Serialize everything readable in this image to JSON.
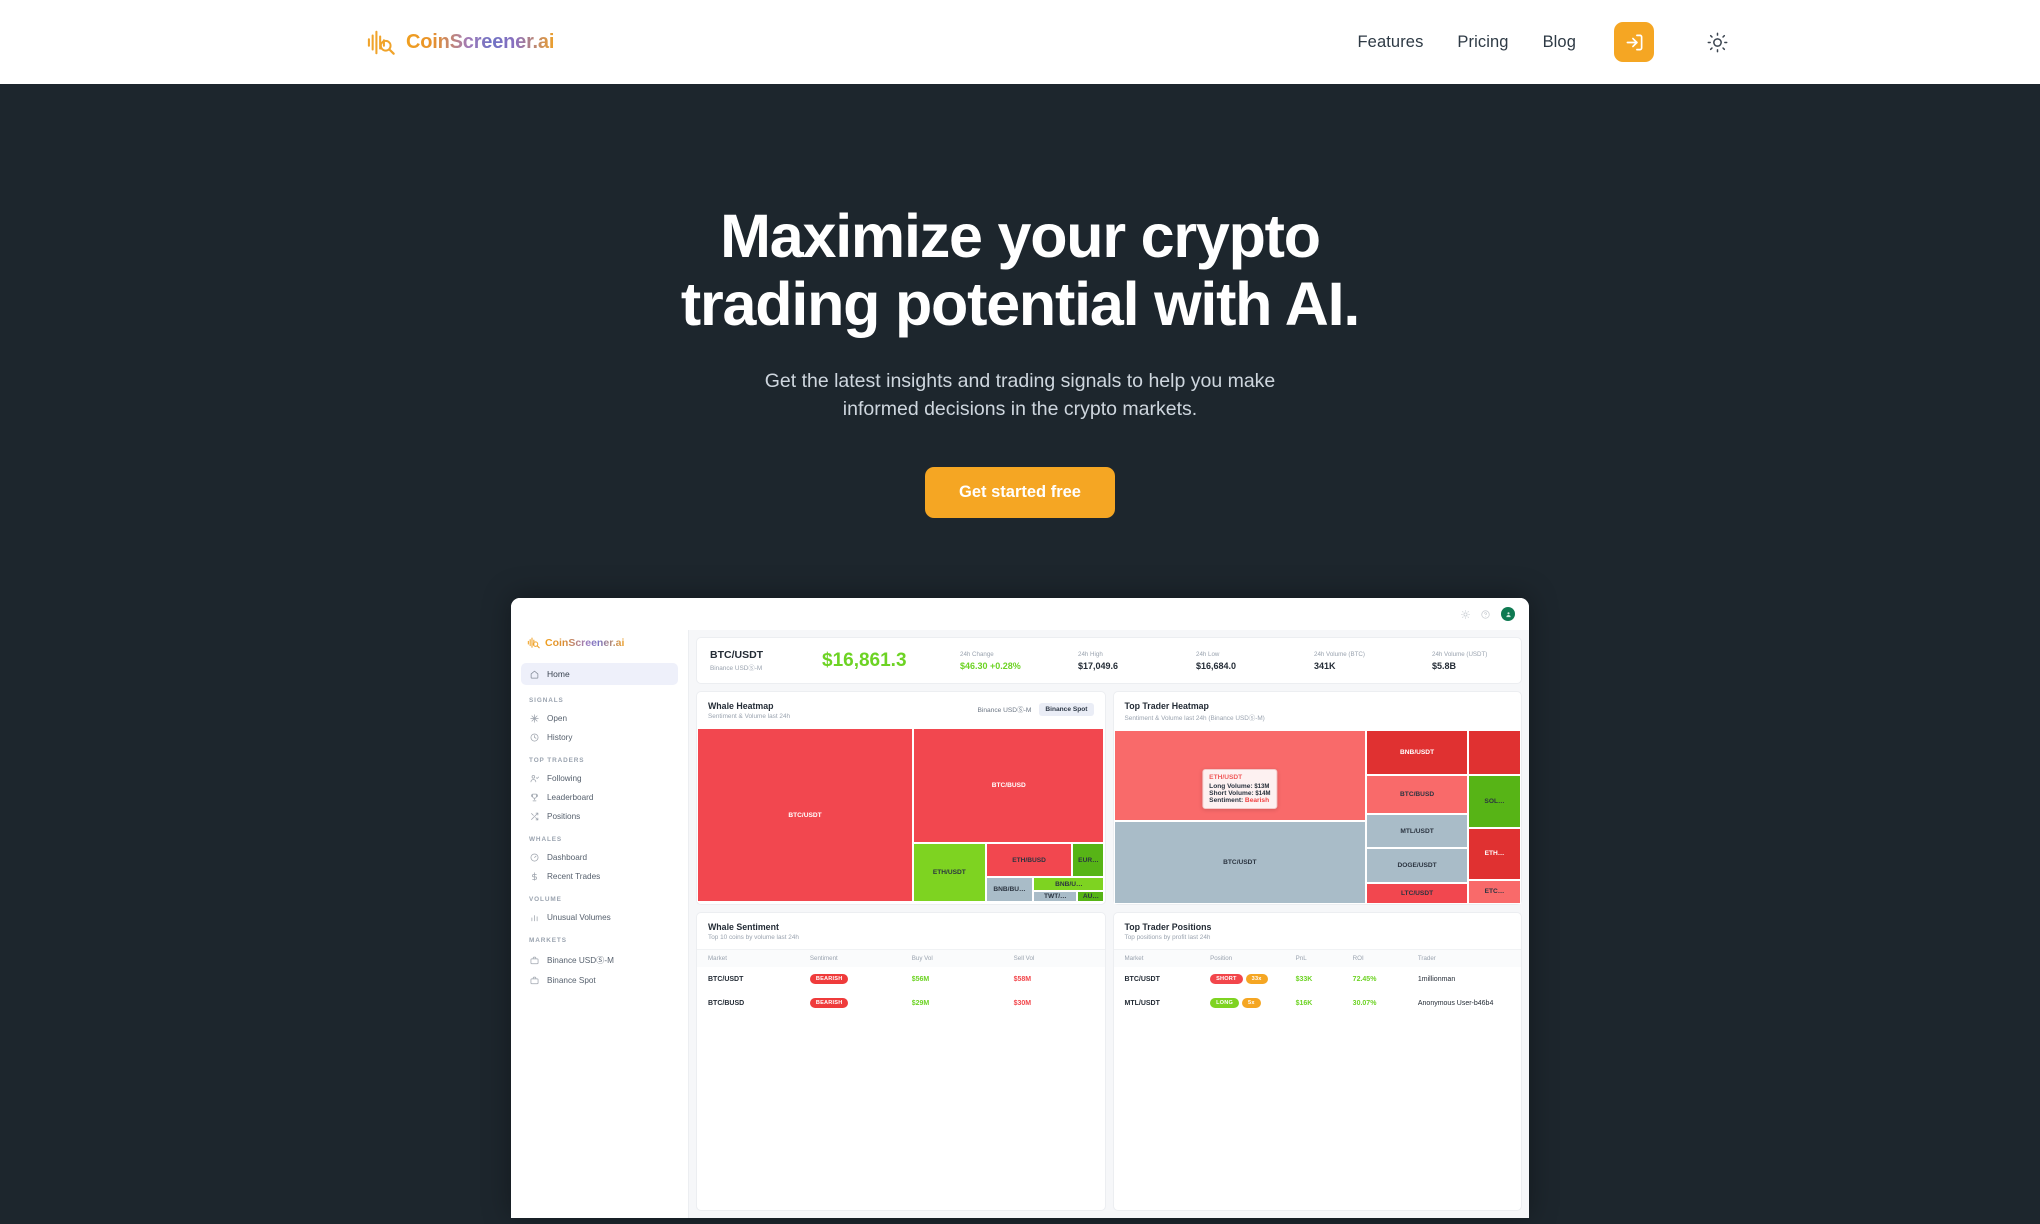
{
  "site": {
    "brand": "CoinScreener.ai",
    "accent": "#f5a623",
    "nav": [
      {
        "label": "Features"
      },
      {
        "label": "Pricing"
      },
      {
        "label": "Blog"
      }
    ],
    "login_icon": "login-arrow-icon",
    "theme_icon": "sun-icon"
  },
  "hero": {
    "title_line1": "Maximize your crypto",
    "title_line2": "trading potential with AI.",
    "subtitle_line1": "Get the latest insights and trading signals to help you make",
    "subtitle_line2": "informed decisions in the crypto markets.",
    "cta": "Get started free"
  },
  "dashboard": {
    "brand": "CoinScreener.ai",
    "topbar_icons": [
      "sun-icon",
      "help-icon",
      "avatar"
    ],
    "sidebar": {
      "active": {
        "label": "Home",
        "icon": "home-icon"
      },
      "groups": [
        {
          "title": "SIGNALS",
          "items": [
            {
              "label": "Open",
              "icon": "sparkle-icon"
            },
            {
              "label": "History",
              "icon": "clock-icon"
            }
          ]
        },
        {
          "title": "TOP TRADERS",
          "items": [
            {
              "label": "Following",
              "icon": "user-check-icon"
            },
            {
              "label": "Leaderboard",
              "icon": "trophy-icon"
            },
            {
              "label": "Positions",
              "icon": "shuffle-icon"
            }
          ]
        },
        {
          "title": "WHALES",
          "items": [
            {
              "label": "Dashboard",
              "icon": "gauge-icon"
            },
            {
              "label": "Recent Trades",
              "icon": "dollar-icon"
            }
          ]
        },
        {
          "title": "VOLUME",
          "items": [
            {
              "label": "Unusual Volumes",
              "icon": "bar-chart-icon"
            }
          ]
        },
        {
          "title": "MARKETS",
          "items": [
            {
              "label": "Binance USDⓈ-M",
              "icon": "briefcase-icon"
            },
            {
              "label": "Binance Spot",
              "icon": "briefcase-icon"
            }
          ]
        }
      ]
    },
    "ticker": {
      "pair": "BTC/USDT",
      "exchange": "Binance USDⓈ-M",
      "price": "$16,861.3",
      "stats": [
        {
          "label": "24h Change",
          "value": "$46.30 +0.28%",
          "up": true
        },
        {
          "label": "24h High",
          "value": "$17,049.6",
          "up": false
        },
        {
          "label": "24h Low",
          "value": "$16,684.0",
          "up": false
        },
        {
          "label": "24h Volume (BTC)",
          "value": "341K",
          "up": false
        },
        {
          "label": "24h Volume (USDT)",
          "value": "$5.8B",
          "up": false
        }
      ]
    },
    "whale_heatmap": {
      "title": "Whale Heatmap",
      "subtitle": "Sentiment & Volume last 24h",
      "segments": [
        {
          "label": "Binance USDⓈ-M",
          "selected": false
        },
        {
          "label": "Binance Spot",
          "selected": true
        }
      ]
    },
    "trader_heatmap": {
      "title": "Top Trader Heatmap",
      "subtitle": "Sentiment & Volume last 24h (Binance USDⓈ-M)",
      "tooltip": {
        "pair": "ETH/USDT",
        "long_label": "Long Volume:",
        "long_value": "$13M",
        "short_label": "Short Volume:",
        "short_value": "$14M",
        "sentiment_label": "Sentiment:",
        "sentiment_value": "Bearish"
      }
    },
    "whale_sentiment": {
      "title": "Whale Sentiment",
      "subtitle": "Top 10 coins by volume last 24h",
      "columns": [
        "Market",
        "Sentiment",
        "Buy Vol",
        "Sell Vol"
      ],
      "rows": [
        {
          "market": "BTC/USDT",
          "sentiment": "BEARISH",
          "buy": "$56M",
          "sell": "$58M"
        },
        {
          "market": "BTC/BUSD",
          "sentiment": "BEARISH",
          "buy": "$29M",
          "sell": "$30M"
        }
      ]
    },
    "trader_positions": {
      "title": "Top Trader Positions",
      "subtitle": "Top positions by profit last 24h",
      "columns": [
        "Market",
        "Position",
        "PnL",
        "ROI",
        "Trader"
      ],
      "rows": [
        {
          "market": "BTC/USDT",
          "side": "SHORT",
          "lev": "33x",
          "pnl": "$33K",
          "roi": "72.45%",
          "trader": "1millionman"
        },
        {
          "market": "MTL/USDT",
          "side": "LONG",
          "lev": "5x",
          "pnl": "$16K",
          "roi": "30.07%",
          "trader": "Anonymous User-b46b4"
        }
      ]
    }
  },
  "chart_data": [
    {
      "type": "heatmap",
      "title": "Whale Heatmap",
      "subtitle": "Sentiment & Volume last 24h",
      "layout": "treemap",
      "colors": {
        "bearish": "#f2474f",
        "bullish": "#7ed321",
        "bullish_dark": "#57b416",
        "neutral": "#a9bcc8"
      },
      "tiles": [
        {
          "label": "BTC/USDT",
          "sentiment": "bearish",
          "weight": 45
        },
        {
          "label": "BTC/BUSD",
          "sentiment": "bearish",
          "weight": 26
        },
        {
          "label": "ETH/USDT",
          "sentiment": "bullish",
          "weight": 8
        },
        {
          "label": "ETH/BUSD",
          "sentiment": "bearish",
          "weight": 7
        },
        {
          "label": "EUR…",
          "sentiment": "bullish_dark",
          "weight": 3
        },
        {
          "label": "BNB/BU…",
          "sentiment": "neutral",
          "weight": 2
        },
        {
          "label": "BNB/U…",
          "sentiment": "bullish",
          "weight": 2
        },
        {
          "label": "TWT/…",
          "sentiment": "neutral",
          "weight": 1
        },
        {
          "label": "AU…",
          "sentiment": "bullish_dark",
          "weight": 1
        }
      ]
    },
    {
      "type": "heatmap",
      "title": "Top Trader Heatmap",
      "subtitle": "Sentiment & Volume last 24h (Binance USDⓈ-M)",
      "layout": "treemap",
      "colors": {
        "bearish": "#f96a6a",
        "bearish_dark": "#e03131",
        "bullish": "#57b416",
        "neutral": "#a9bcc8"
      },
      "tiles": [
        {
          "label": "ETH/USDT",
          "sentiment": "bearish",
          "weight": 30,
          "long_volume": "$13M",
          "short_volume": "$14M"
        },
        {
          "label": "BTC/USDT",
          "sentiment": "neutral",
          "weight": 28
        },
        {
          "label": "BNB/USDT",
          "sentiment": "bearish_dark",
          "weight": 9
        },
        {
          "label": "BTC/BUSD",
          "sentiment": "bearish",
          "weight": 6
        },
        {
          "label": "SOL…",
          "sentiment": "bullish",
          "weight": 5
        },
        {
          "label": "MTL/USDT",
          "sentiment": "neutral",
          "weight": 5
        },
        {
          "label": "ETH…",
          "sentiment": "bearish_dark",
          "weight": 4
        },
        {
          "label": "DOGE/USDT",
          "sentiment": "neutral",
          "weight": 5
        },
        {
          "label": "LTC/USDT",
          "sentiment": "bearish",
          "weight": 4
        },
        {
          "label": "ETC…",
          "sentiment": "bearish",
          "weight": 2
        }
      ]
    }
  ]
}
